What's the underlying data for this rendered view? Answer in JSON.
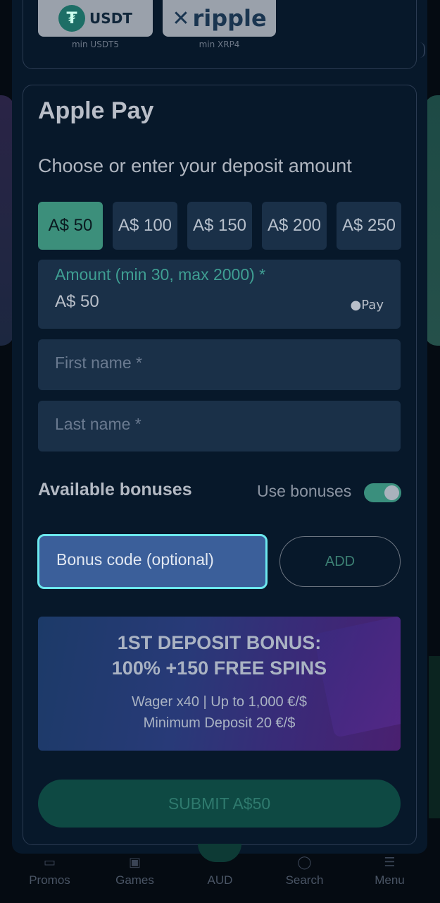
{
  "crypto": {
    "coins": [
      {
        "name": "USDT",
        "min": "min USDT5"
      },
      {
        "name": "ripple",
        "min": "min XRP4"
      }
    ]
  },
  "apple_pay": {
    "title": "Apple Pay",
    "subtitle": "Choose or enter your deposit amount",
    "amounts": [
      "A$ 50",
      "A$ 100",
      "A$ 150",
      "A$ 200",
      "A$ 250"
    ],
    "selected_amount_index": 0,
    "amount_field": {
      "label": "Amount (min 30, max 2000) *",
      "value": "A$ 50",
      "pay_badge": "Pay"
    },
    "first_name_placeholder": "First name *",
    "last_name_placeholder": "Last name *",
    "bonuses_title": "Available bonuses",
    "use_bonuses_label": "Use bonuses",
    "use_bonuses_on": true,
    "bonus_code_placeholder": "Bonus code (optional)",
    "add_label": "ADD",
    "promo": {
      "line1": "1ST DEPOSIT BONUS:",
      "line2": "100% +150 FREE SPINS",
      "line3": "Wager x40 | Up to 1,000 €/$",
      "line4": "Minimum Deposit 20 €/$"
    },
    "submit_label": "SUBMIT A$50"
  },
  "nav": {
    "items": [
      {
        "label": "Promos",
        "icon": "promos-icon"
      },
      {
        "label": "Games",
        "icon": "games-icon"
      },
      {
        "label": "AUD",
        "icon": "aud-icon"
      },
      {
        "label": "Search",
        "icon": "search-icon"
      },
      {
        "label": "Menu",
        "icon": "menu-icon"
      }
    ]
  },
  "colors": {
    "accent": "#3c8f7b",
    "focus": "#6ce8ee",
    "background": "#07182a"
  }
}
